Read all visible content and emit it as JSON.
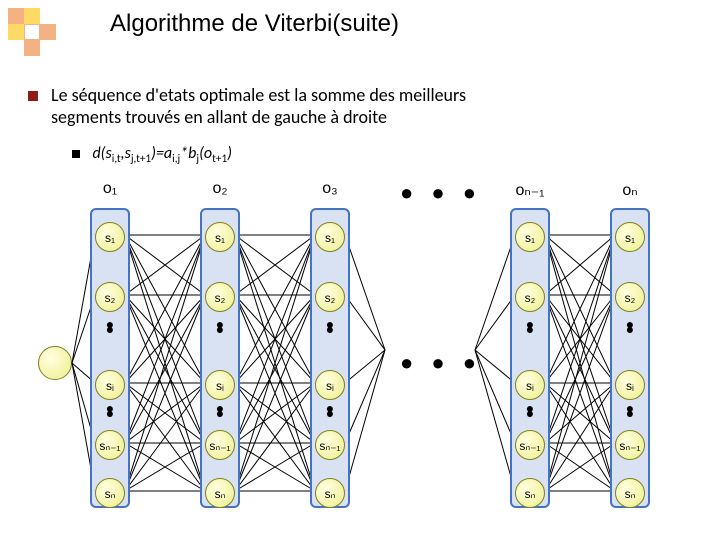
{
  "logo": {
    "colors": [
      "#f4b183",
      "#ffd966",
      "#e2a36a",
      "#fff"
    ]
  },
  "title": "Algorithme de Viterbi(suite)",
  "bullet1_line1": "Le séquence d'etats optimale est la somme des meilleurs",
  "bullet1_line2": "segments trouvés en allant de gauche à droite",
  "formula_html": "d(s<sub>i,t</sub>,s<sub>j,t+1</sub>)=a<sub>i,j</sub>*b<sub>j</sub>(o<sub>t+1</sub>)",
  "obs": [
    "o₁",
    "o₂",
    "o₃",
    "oₙ₋₁",
    "oₙ"
  ],
  "states": [
    "s₁",
    "s₂",
    "sᵢ",
    "sₙ₋₁",
    "sₙ"
  ],
  "chart_data": {
    "type": "diagram",
    "description": "Viterbi trellis: columns are observations o1..on, each column holds states s1..sn; edges fully connect states of adjacent columns; optimal path is best sum of segment costs d(s_{i,t},s_{j,t+1})=a_{i,j}*b_j(o_{t+1}).",
    "columns": [
      "o1",
      "o2",
      "o3",
      "...",
      "o_{n-1}",
      "o_n"
    ],
    "states_per_column": [
      "s1",
      "s2",
      "...",
      "s_i",
      "...",
      "s_{n-1}",
      "s_n"
    ]
  }
}
